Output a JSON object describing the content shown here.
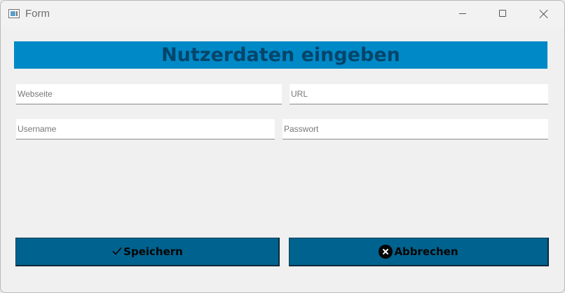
{
  "window": {
    "title": "Form"
  },
  "header": {
    "title": "Nutzerdaten eingeben"
  },
  "form": {
    "webseite": {
      "value": "",
      "placeholder": "Webseite"
    },
    "url": {
      "value": "",
      "placeholder": "URL"
    },
    "username": {
      "value": "",
      "placeholder": "Username"
    },
    "passwort": {
      "value": "",
      "placeholder": "Passwort"
    }
  },
  "buttons": {
    "save_label": "Speichern",
    "cancel_label": "Abbrechen",
    "save_icon": "check-icon",
    "cancel_icon": "close-circle-icon"
  },
  "colors": {
    "banner": "#0089c7",
    "banner_text": "#06456b",
    "button_bg": "#00628e"
  }
}
